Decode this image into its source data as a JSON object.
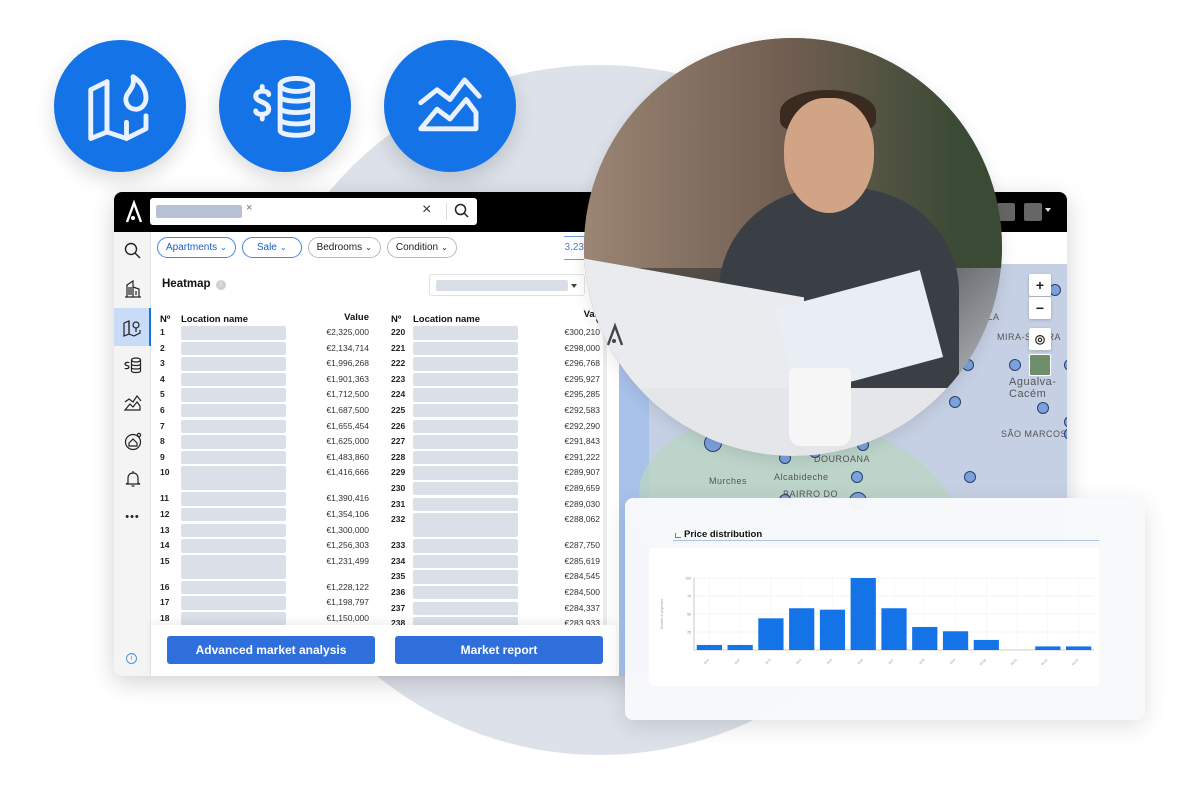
{
  "feature_icons": [
    {
      "name": "heatmap-map-icon",
      "color": "#1473e6"
    },
    {
      "name": "price-database-icon",
      "color": "#1473e6"
    },
    {
      "name": "market-trend-icon",
      "color": "#1473e6"
    }
  ],
  "header": {
    "logo_glyph": "Λ",
    "search": {
      "chip_value": "",
      "clear_glyph": "×",
      "chip_remove_glyph": "×"
    }
  },
  "sidebar": {
    "items": [
      {
        "name": "search",
        "active": false
      },
      {
        "name": "buildings",
        "active": false
      },
      {
        "name": "heatmap",
        "active": true
      },
      {
        "name": "price-data",
        "active": false
      },
      {
        "name": "market-trend",
        "active": false
      },
      {
        "name": "home-valuation",
        "active": false
      },
      {
        "name": "alerts",
        "active": false
      },
      {
        "name": "more",
        "active": false
      }
    ],
    "more_glyph": "•••",
    "info_glyph": "i"
  },
  "filters": [
    {
      "label": "Apartments",
      "selected": true
    },
    {
      "label": "Sale",
      "selected": true
    },
    {
      "label": "Bedrooms",
      "selected": false
    },
    {
      "label": "Condition",
      "selected": false
    }
  ],
  "partial_tab_text": "3.23",
  "heatmap": {
    "title": "Heatmap",
    "info_glyph": "i",
    "dropdown_value": "",
    "columns": {
      "number": "Nº",
      "location": "Location name",
      "value": "Value",
      "value_right": "Val.",
      "value_right_sub": "€"
    },
    "left_rows": [
      {
        "n": "1",
        "value": "€2,325,000",
        "tall": false
      },
      {
        "n": "2",
        "value": "€2,134,714",
        "tall": false
      },
      {
        "n": "3",
        "value": "€1,996,268",
        "tall": false
      },
      {
        "n": "4",
        "value": "€1,901,363",
        "tall": false
      },
      {
        "n": "5",
        "value": "€1,712,500",
        "tall": false
      },
      {
        "n": "6",
        "value": "€1,687,500",
        "tall": false
      },
      {
        "n": "7",
        "value": "€1,655,454",
        "tall": false
      },
      {
        "n": "8",
        "value": "€1,625,000",
        "tall": false
      },
      {
        "n": "9",
        "value": "€1,483,860",
        "tall": false
      },
      {
        "n": "10",
        "value": "€1,416,666",
        "tall": true
      },
      {
        "n": "11",
        "value": "€1,390,416",
        "tall": false
      },
      {
        "n": "12",
        "value": "€1,354,106",
        "tall": false
      },
      {
        "n": "13",
        "value": "€1,300,000",
        "tall": false
      },
      {
        "n": "14",
        "value": "€1,256,303",
        "tall": false
      },
      {
        "n": "15",
        "value": "€1,231,499",
        "tall": true
      },
      {
        "n": "16",
        "value": "€1,228,122",
        "tall": false
      },
      {
        "n": "17",
        "value": "€1,198,797",
        "tall": false
      },
      {
        "n": "18",
        "value": "€1,150,000",
        "tall": false
      }
    ],
    "right_rows": [
      {
        "n": "220",
        "value": "€300,210",
        "tall": false
      },
      {
        "n": "221",
        "value": "€298,000",
        "tall": false
      },
      {
        "n": "222",
        "value": "€296,768",
        "tall": false
      },
      {
        "n": "223",
        "value": "€295,927",
        "tall": false
      },
      {
        "n": "224",
        "value": "€295,285",
        "tall": false
      },
      {
        "n": "225",
        "value": "€292,583",
        "tall": false
      },
      {
        "n": "226",
        "value": "€292,290",
        "tall": false
      },
      {
        "n": "227",
        "value": "€291,843",
        "tall": false
      },
      {
        "n": "228",
        "value": "€291,222",
        "tall": false
      },
      {
        "n": "229",
        "value": "€289,907",
        "tall": false
      },
      {
        "n": "230",
        "value": "€289,659",
        "tall": false
      },
      {
        "n": "231",
        "value": "€289,030",
        "tall": false
      },
      {
        "n": "232",
        "value": "€288,062",
        "tall": true
      },
      {
        "n": "233",
        "value": "€287,750",
        "tall": false
      },
      {
        "n": "234",
        "value": "€285,619",
        "tall": false
      },
      {
        "n": "235",
        "value": "€284,545",
        "tall": false
      },
      {
        "n": "236",
        "value": "€284,500",
        "tall": false
      },
      {
        "n": "237",
        "value": "€284,337",
        "tall": false
      },
      {
        "n": "238",
        "value": "€283,933",
        "tall": false
      }
    ]
  },
  "actions": {
    "advanced_label": "Advanced market analysis",
    "report_label": "Market report"
  },
  "map": {
    "labels": [
      "Agualva-Cacém",
      "SÃO MARCOS",
      "DOUROANA",
      "Alcabideche",
      "Murches",
      "BAIRRO DO",
      "MIRA-SINTRA",
      "ALA"
    ],
    "controls": {
      "zoom_in": "+",
      "zoom_out": "−",
      "locate": "◎"
    }
  },
  "colors": {
    "accent": "#1473e6",
    "button": "#2f6fdb",
    "bar": "#1473e6",
    "topbar": "#000000"
  },
  "chart_data": {
    "type": "bar",
    "title": "Price distribution",
    "xlabel": "",
    "ylabel": "Number of properties",
    "categories": [
      "bin1",
      "bin2",
      "bin3",
      "bin4",
      "bin5",
      "bin6",
      "bin7",
      "bin8",
      "bin9",
      "bin10",
      "bin11",
      "bin12",
      "bin13"
    ],
    "values": [
      7,
      7,
      44,
      58,
      56,
      100,
      58,
      32,
      26,
      14,
      0,
      5,
      5
    ],
    "ylim": [
      0,
      100
    ],
    "yticks": [
      "25",
      "50",
      "75",
      "100"
    ],
    "grid": true,
    "legend": "none"
  }
}
